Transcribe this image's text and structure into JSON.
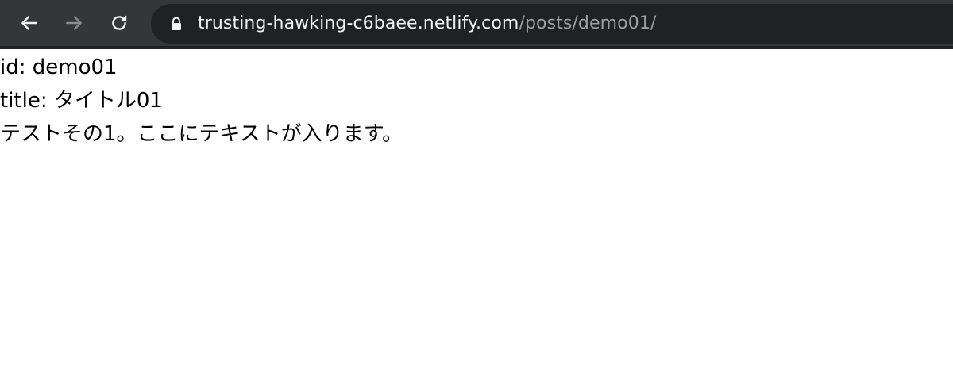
{
  "browser": {
    "nav": {
      "back_icon": "arrow-left-icon",
      "forward_icon": "arrow-right-icon",
      "reload_icon": "reload-icon"
    },
    "address_bar": {
      "lock_icon": "lock-icon",
      "host": "trusting-hawking-c6baee.netlify.com",
      "path": "/posts/demo01/"
    },
    "colors": {
      "toolbar": "#35363a",
      "omnibox": "#202124",
      "host_text": "#f1f3f4",
      "path_text": "#9aa0a6"
    }
  },
  "page": {
    "id_line": "id: demo01",
    "title_line": "title: タイトル01",
    "body_line": "テストその1。ここにテキストが入ります。"
  }
}
